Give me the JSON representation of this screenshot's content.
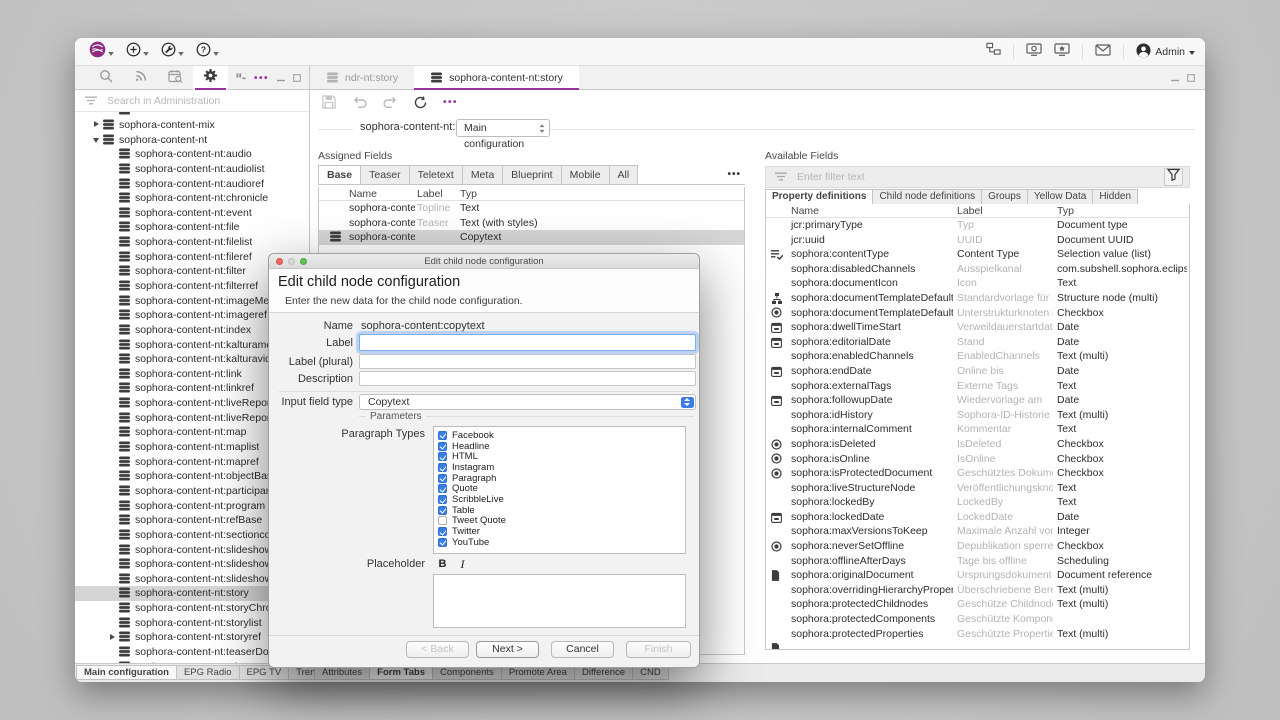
{
  "colors": {
    "accent": "#993399",
    "checkbox_blue": "#3b7de8",
    "selection": "#d5d5d5"
  },
  "menubar": {
    "user_label": "Admin"
  },
  "window": {
    "main_tabs": [
      {
        "label": "ndr-nt:story",
        "active": false
      },
      {
        "label": "sophora-content-nt:story",
        "active": true
      }
    ]
  },
  "sidebar": {
    "search_placeholder": "Search in Administration",
    "tree": [
      {
        "chevron": "none",
        "indent": 2,
        "icon": "db",
        "label": ""
      },
      {
        "chevron": "right",
        "indent": 1,
        "icon": "db",
        "label": "sophora-content-mix"
      },
      {
        "chevron": "down",
        "indent": 1,
        "icon": "db",
        "label": "sophora-content-nt"
      },
      {
        "chevron": "none",
        "indent": 2,
        "icon": "db",
        "label": "sophora-content-nt:audio"
      },
      {
        "chevron": "none",
        "indent": 2,
        "icon": "db",
        "label": "sophora-content-nt:audiolist"
      },
      {
        "chevron": "none",
        "indent": 2,
        "icon": "db",
        "label": "sophora-content-nt:audioref"
      },
      {
        "chevron": "none",
        "indent": 2,
        "icon": "db",
        "label": "sophora-content-nt:chronicle"
      },
      {
        "chevron": "none",
        "indent": 2,
        "icon": "db",
        "label": "sophora-content-nt:event"
      },
      {
        "chevron": "none",
        "indent": 2,
        "icon": "db",
        "label": "sophora-content-nt:file"
      },
      {
        "chevron": "none",
        "indent": 2,
        "icon": "db",
        "label": "sophora-content-nt:filelist"
      },
      {
        "chevron": "none",
        "indent": 2,
        "icon": "db",
        "label": "sophora-content-nt:fileref"
      },
      {
        "chevron": "none",
        "indent": 2,
        "icon": "db",
        "label": "sophora-content-nt:filter"
      },
      {
        "chevron": "none",
        "indent": 2,
        "icon": "db",
        "label": "sophora-content-nt:filterref"
      },
      {
        "chevron": "none",
        "indent": 2,
        "icon": "db",
        "label": "sophora-content-nt:imageMetaDataT…"
      },
      {
        "chevron": "none",
        "indent": 2,
        "icon": "db",
        "label": "sophora-content-nt:imageref"
      },
      {
        "chevron": "none",
        "indent": 2,
        "icon": "db",
        "label": "sophora-content-nt:index"
      },
      {
        "chevron": "none",
        "indent": 2,
        "icon": "db",
        "label": "sophora-content-nt:kalturamediathek…"
      },
      {
        "chevron": "none",
        "indent": 2,
        "icon": "db",
        "label": "sophora-content-nt:kalturavideoref"
      },
      {
        "chevron": "none",
        "indent": 2,
        "icon": "db",
        "label": "sophora-content-nt:link"
      },
      {
        "chevron": "none",
        "indent": 2,
        "icon": "db",
        "label": "sophora-content-nt:linkref"
      },
      {
        "chevron": "none",
        "indent": 2,
        "icon": "db",
        "label": "sophora-content-nt:liveReporting"
      },
      {
        "chevron": "none",
        "indent": 2,
        "icon": "db",
        "label": "sophora-content-nt:liveReportingEntr…"
      },
      {
        "chevron": "none",
        "indent": 2,
        "icon": "db",
        "label": "sophora-content-nt:map"
      },
      {
        "chevron": "none",
        "indent": 2,
        "icon": "db",
        "label": "sophora-content-nt:maplist"
      },
      {
        "chevron": "none",
        "indent": 2,
        "icon": "db",
        "label": "sophora-content-nt:mapref"
      },
      {
        "chevron": "none",
        "indent": 2,
        "icon": "db",
        "label": "sophora-content-nt:objectBase"
      },
      {
        "chevron": "none",
        "indent": 2,
        "icon": "db",
        "label": "sophora-content-nt:participantTableR…"
      },
      {
        "chevron": "none",
        "indent": 2,
        "icon": "db",
        "label": "sophora-content-nt:program"
      },
      {
        "chevron": "none",
        "indent": 2,
        "icon": "db",
        "label": "sophora-content-nt:refBase"
      },
      {
        "chevron": "none",
        "indent": 2,
        "icon": "db",
        "label": "sophora-content-nt:sectionconfigurat…"
      },
      {
        "chevron": "none",
        "indent": 2,
        "icon": "db",
        "label": "sophora-content-nt:slideshow"
      },
      {
        "chevron": "none",
        "indent": 2,
        "icon": "db",
        "label": "sophora-content-nt:slideshowlist"
      },
      {
        "chevron": "none",
        "indent": 2,
        "icon": "db",
        "label": "sophora-content-nt:slideshowref"
      },
      {
        "chevron": "none",
        "indent": 2,
        "icon": "db",
        "label": "sophora-content-nt:story",
        "selected": true
      },
      {
        "chevron": "none",
        "indent": 2,
        "icon": "db",
        "label": "sophora-content-nt:storyChronicleRe…"
      },
      {
        "chevron": "none",
        "indent": 2,
        "icon": "db",
        "label": "sophora-content-nt:storylist"
      },
      {
        "chevron": "right",
        "indent": 2,
        "icon": "db",
        "label": "sophora-content-nt:storyref"
      },
      {
        "chevron": "none",
        "indent": 2,
        "icon": "db",
        "label": "sophora-content-nt:teaserDocumentE…"
      },
      {
        "chevron": "none",
        "indent": 2,
        "icon": "db",
        "label": "sophora-content-nt:teletextBackgrou…"
      }
    ],
    "bottom_tabs": [
      {
        "label": "Main configuration",
        "active": true
      },
      {
        "label": "EPG Radio"
      },
      {
        "label": "EPG TV"
      },
      {
        "label": "Trendcities"
      }
    ]
  },
  "main": {
    "doc_type": "sophora-content-nt:story",
    "config_select_value": "Main configuration",
    "assigned": {
      "title": "Assigned Fields",
      "tabs": [
        {
          "label": "Base",
          "active": true
        },
        {
          "label": "Teaser"
        },
        {
          "label": "Teletext"
        },
        {
          "label": "Meta"
        },
        {
          "label": "Blueprint"
        },
        {
          "label": "Mobile"
        },
        {
          "label": "All"
        }
      ],
      "more_label": "•••",
      "columns": [
        "Name",
        "Label",
        "Typ"
      ],
      "rows": [
        {
          "icon": "abc",
          "name": "sophora-content:t…",
          "label": "Topline",
          "typ": "Text"
        },
        {
          "icon": "abc",
          "name": "sophora-content:s…",
          "label": "Teaser",
          "typ": "Text (with styles)"
        },
        {
          "icon": "db",
          "name": "sophora-content:c…",
          "label": "",
          "typ": "Copytext",
          "selected": true
        }
      ]
    },
    "available": {
      "title": "Available Fields",
      "filter_placeholder": "Enter filter text",
      "tabs": [
        {
          "label": "Property definitions",
          "active": true
        },
        {
          "label": "Child node definitions"
        },
        {
          "label": "Groups"
        },
        {
          "label": "Yellow Data"
        },
        {
          "label": "Hidden"
        }
      ],
      "columns": [
        "Name",
        "Label",
        "Typ"
      ],
      "rows": [
        {
          "icon": "none",
          "name": "jcr:primaryType",
          "label": "Typ",
          "typ": "Document type"
        },
        {
          "icon": "none",
          "name": "jcr:uuid",
          "label": "UUID",
          "typ": "Document UUID"
        },
        {
          "icon": "list",
          "name": "sophora:contentType",
          "label": "Content Type",
          "labelDark": true,
          "typ": "Selection value (list)"
        },
        {
          "icon": "none",
          "name": "sophora:disabledChannels",
          "label": "Ausspielkanal",
          "typ": "com.subshell.sophora.eclipse.select…"
        },
        {
          "icon": "abc",
          "name": "sophora:documentIcon",
          "label": "Icon",
          "typ": "Text"
        },
        {
          "icon": "tree",
          "name": "sophora:documentTemplateDefaultForStructur…",
          "label": "Standardvorlage für Strukt…",
          "typ": "Structure node (multi)"
        },
        {
          "icon": "radio",
          "name": "sophora:documentTemplateDefaultForStructur…",
          "label": "Unterstrukturknoten einbez…",
          "typ": "Checkbox"
        },
        {
          "icon": "cal",
          "name": "sophora:dwellTimeStart",
          "label": "Verweildauerstartdatum",
          "typ": "Date"
        },
        {
          "icon": "cal",
          "name": "sophora:editorialDate",
          "label": "Stand",
          "typ": "Date"
        },
        {
          "icon": "none",
          "name": "sophora:enabledChannels",
          "label": "EnabledChannels",
          "typ": "Text (multi)"
        },
        {
          "icon": "cal",
          "name": "sophora:endDate",
          "label": "Online bis",
          "typ": "Date"
        },
        {
          "icon": "abc",
          "name": "sophora:externalTags",
          "label": "Externe Tags",
          "typ": "Text"
        },
        {
          "icon": "cal",
          "name": "sophora:followupDate",
          "label": "Wiedervorlage am",
          "typ": "Date"
        },
        {
          "icon": "none",
          "name": "sophora:idHistory",
          "label": "Sophora-ID-Historie",
          "typ": "Text (multi)"
        },
        {
          "icon": "abc",
          "name": "sophora:internalComment",
          "label": "Kommentar",
          "typ": "Text"
        },
        {
          "icon": "radio",
          "name": "sophora:isDeleted",
          "label": "IsDeleted",
          "typ": "Checkbox"
        },
        {
          "icon": "radio",
          "name": "sophora:isOnline",
          "label": "IsOnline",
          "typ": "Checkbox"
        },
        {
          "icon": "radio",
          "name": "sophora:isProtectedDocument",
          "label": "Geschütztes Dokument",
          "typ": "Checkbox"
        },
        {
          "icon": "abc",
          "name": "sophora:liveStructureNode",
          "label": "Veröffentlichungsknoten",
          "typ": "Text"
        },
        {
          "icon": "abc",
          "name": "sophora:lockedBy",
          "label": "LockedBy",
          "typ": "Text"
        },
        {
          "icon": "cal",
          "name": "sophora:lockedDate",
          "label": "LockedDate",
          "typ": "Date"
        },
        {
          "icon": "n123",
          "name": "sophora:maxVersionsToKeep",
          "label": "Maximale Anzahl von Versi…",
          "typ": "Integer"
        },
        {
          "icon": "radio",
          "name": "sophora:neverSetOffline",
          "label": "Depublikation sperren",
          "typ": "Checkbox"
        },
        {
          "icon": "n123",
          "name": "sophora:offlineAfterDays",
          "label": "Tage bis offline",
          "typ": "Scheduling"
        },
        {
          "icon": "doc",
          "name": "sophora:originalDocument",
          "label": "Ursprungsdokument",
          "typ": "Document reference"
        },
        {
          "icon": "none",
          "name": "sophora:overridingHierarchyProperties",
          "label": "Überschriebene Bereichpro…",
          "typ": "Text (multi)"
        },
        {
          "icon": "none",
          "name": "sophora:protectedChildnodes",
          "label": "Geschütze Childnodes",
          "typ": "Text (multi)"
        },
        {
          "icon": "n123",
          "name": "sophora:protectedComponents",
          "label": "Geschützte Komponenten",
          "typ": ""
        },
        {
          "icon": "none",
          "name": "sophora:protectedProperties",
          "label": "Geschützte Properties",
          "typ": "Text (multi)"
        },
        {
          "icon": "doc",
          "name": "",
          "label": "",
          "typ": ""
        }
      ]
    },
    "bottom_tabs": [
      {
        "label": "Attributes"
      },
      {
        "label": "Form Tabs",
        "active": true
      },
      {
        "label": "Components"
      },
      {
        "label": "Promote Area"
      },
      {
        "label": "Difference"
      },
      {
        "label": "CND"
      }
    ]
  },
  "dialog": {
    "window_title": "Edit child node configuration",
    "heading": "Edit child node configuration",
    "subtitle": "Enter the new data for the child node configuration.",
    "fields": {
      "name_label": "Name",
      "name_value": "sophora-content:copytext",
      "label_label": "Label",
      "label_value": "",
      "label_plural_label": "Label (plural)",
      "label_plural_value": "",
      "description_label": "Description",
      "description_value": "",
      "input_field_type_label": "Input field type",
      "input_field_type_value": "Copytext"
    },
    "parameters": {
      "group_label": "Parameters",
      "paragraph_types_label": "Paragraph Types",
      "items": [
        {
          "label": "Facebook",
          "checked": true
        },
        {
          "label": "Headline",
          "checked": true
        },
        {
          "label": "HTML",
          "checked": true
        },
        {
          "label": "Instagram",
          "checked": true
        },
        {
          "label": "Paragraph",
          "checked": true
        },
        {
          "label": "Quote",
          "checked": true
        },
        {
          "label": "ScribbleLive",
          "checked": true
        },
        {
          "label": "Table",
          "checked": true
        },
        {
          "label": "Tweet Quote",
          "checked": false
        },
        {
          "label": "Twitter",
          "checked": true
        },
        {
          "label": "YouTube",
          "checked": true
        }
      ],
      "placeholder_label": "Placeholder",
      "bold_label": "B",
      "italic_label": "I",
      "placeholder_value": ""
    },
    "buttons": [
      {
        "label": "< Back",
        "disabled": true
      },
      {
        "label": "Next >"
      },
      {
        "label": "Cancel"
      },
      {
        "label": "Finish",
        "disabled": true
      }
    ]
  }
}
